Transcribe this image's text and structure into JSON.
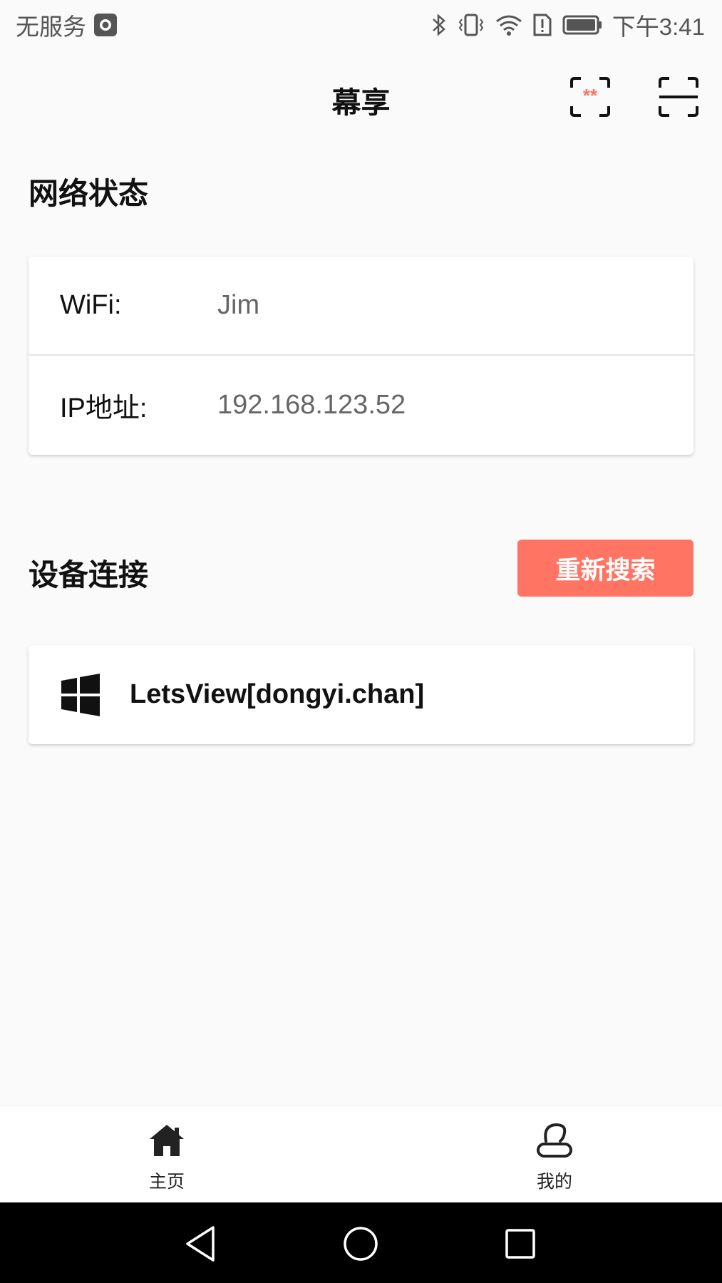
{
  "status_bar": {
    "carrier": "无服务",
    "time": "下午3:41"
  },
  "app_bar": {
    "title": "幕享",
    "icons": [
      "pin-code-icon",
      "scan-icon"
    ]
  },
  "network": {
    "section_title": "网络状态",
    "rows": [
      {
        "label": "WiFi:",
        "value": "Jim"
      },
      {
        "label": "IP地址:",
        "value": "192.168.123.52"
      }
    ]
  },
  "devices": {
    "section_title": "设备连接",
    "research_label": "重新搜索",
    "items": [
      {
        "name": "LetsView[dongyi.chan]",
        "icon": "windows-icon"
      }
    ]
  },
  "bottom_nav": {
    "items": [
      {
        "label": "主页",
        "icon": "home-icon"
      },
      {
        "label": "我的",
        "icon": "user-icon"
      }
    ]
  },
  "colors": {
    "accent": "#ff7462",
    "background": "#fafafa",
    "card": "#ffffff"
  }
}
